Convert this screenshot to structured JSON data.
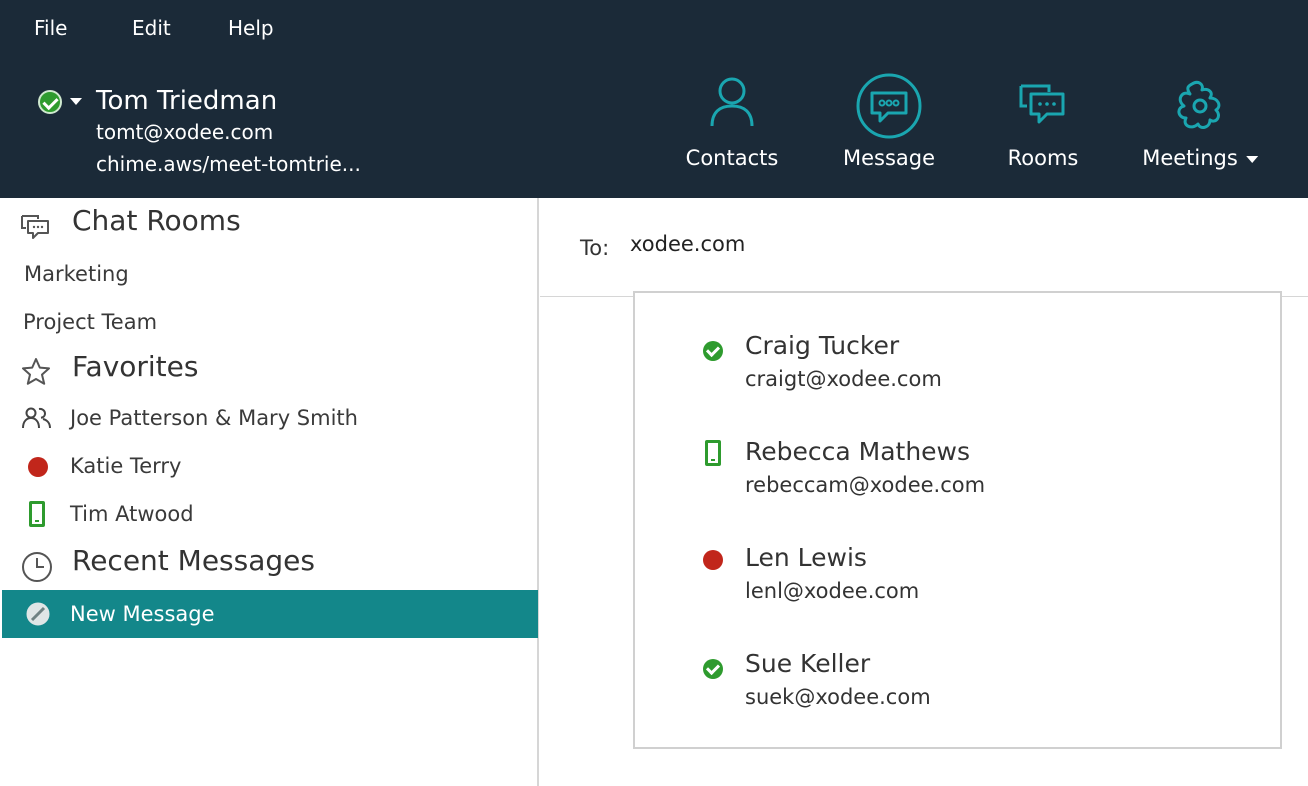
{
  "menu": {
    "file": "File",
    "edit": "Edit",
    "help": "Help"
  },
  "user": {
    "name": "Tom Triedman",
    "email": "tomt@xodee.com",
    "meeting_link": "chime.aws/meet-tomtrie...",
    "status_color": "#2e9b2e"
  },
  "nav": {
    "contacts": "Contacts",
    "message": "Message",
    "rooms": "Rooms",
    "meetings": "Meetings"
  },
  "sidebar": {
    "chat_rooms": {
      "title": "Chat Rooms",
      "items": [
        {
          "label": "Marketing"
        },
        {
          "label": "Project Team"
        }
      ]
    },
    "favorites": {
      "title": "Favorites",
      "items": [
        {
          "label": "Joe Patterson & Mary Smith",
          "icon": "group-icon"
        },
        {
          "label": "Katie Terry",
          "icon": "status-busy-icon"
        },
        {
          "label": "Tim Atwood",
          "icon": "mobile-icon"
        }
      ]
    },
    "recent": {
      "title": "Recent Messages",
      "items": [
        {
          "label": "New Message",
          "icon": "no-status-icon",
          "selected": true
        }
      ]
    }
  },
  "compose": {
    "to_label": "To:",
    "to_value": "xodee.com"
  },
  "suggestions": [
    {
      "name": "Craig Tucker",
      "email": "craigt@xodee.com",
      "status": "available"
    },
    {
      "name": "Rebecca Mathews",
      "email": "rebeccam@xodee.com",
      "status": "mobile"
    },
    {
      "name": "Len Lewis",
      "email": "lenl@xodee.com",
      "status": "busy"
    },
    {
      "name": "Sue Keller",
      "email": "suek@xodee.com",
      "status": "available"
    }
  ],
  "colors": {
    "header_bg": "#1b2a38",
    "accent_teal": "#13878a",
    "icon_teal": "#1aa6b0",
    "available_green": "#2e9b2e",
    "busy_red": "#c1261b"
  }
}
